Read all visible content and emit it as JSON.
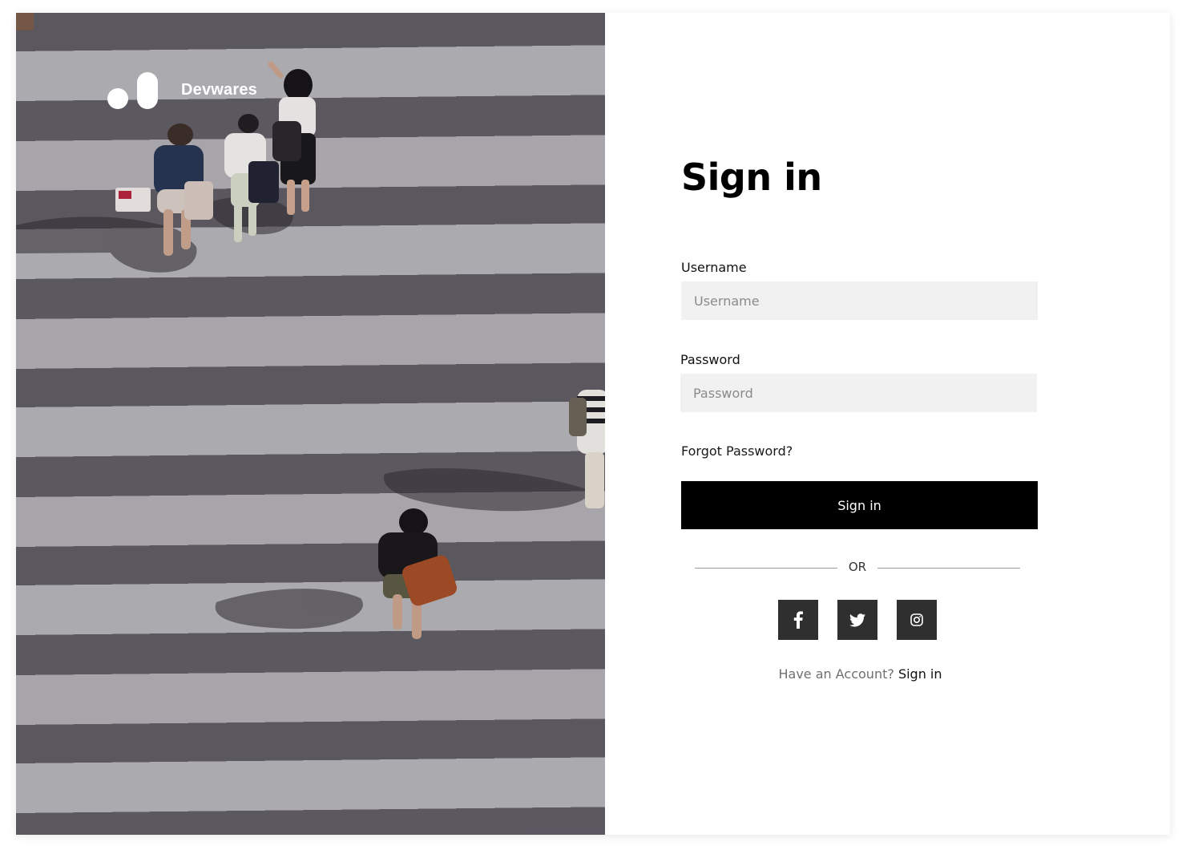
{
  "brand": {
    "name": "Devwares"
  },
  "hero": {
    "image": "pedestrians crossing a zebra crosswalk, aerial view"
  },
  "form": {
    "title": "Sign in",
    "username": {
      "label": "Username",
      "placeholder": "Username",
      "value": ""
    },
    "password": {
      "label": "Password",
      "placeholder": "Password",
      "value": ""
    },
    "forgot_label": "Forgot Password?",
    "submit_label": "Sign in",
    "divider_text": "OR",
    "socials": [
      {
        "name": "facebook",
        "icon": "facebook-icon"
      },
      {
        "name": "twitter",
        "icon": "twitter-icon"
      },
      {
        "name": "instagram",
        "icon": "instagram-icon"
      }
    ],
    "account_prompt": "Have an Account?",
    "account_link": "Sign in"
  },
  "colors": {
    "primary_button": "#000000",
    "social_button": "#2f2f2f",
    "input_background": "#f1f1f1",
    "page_background": "#ffffff"
  }
}
